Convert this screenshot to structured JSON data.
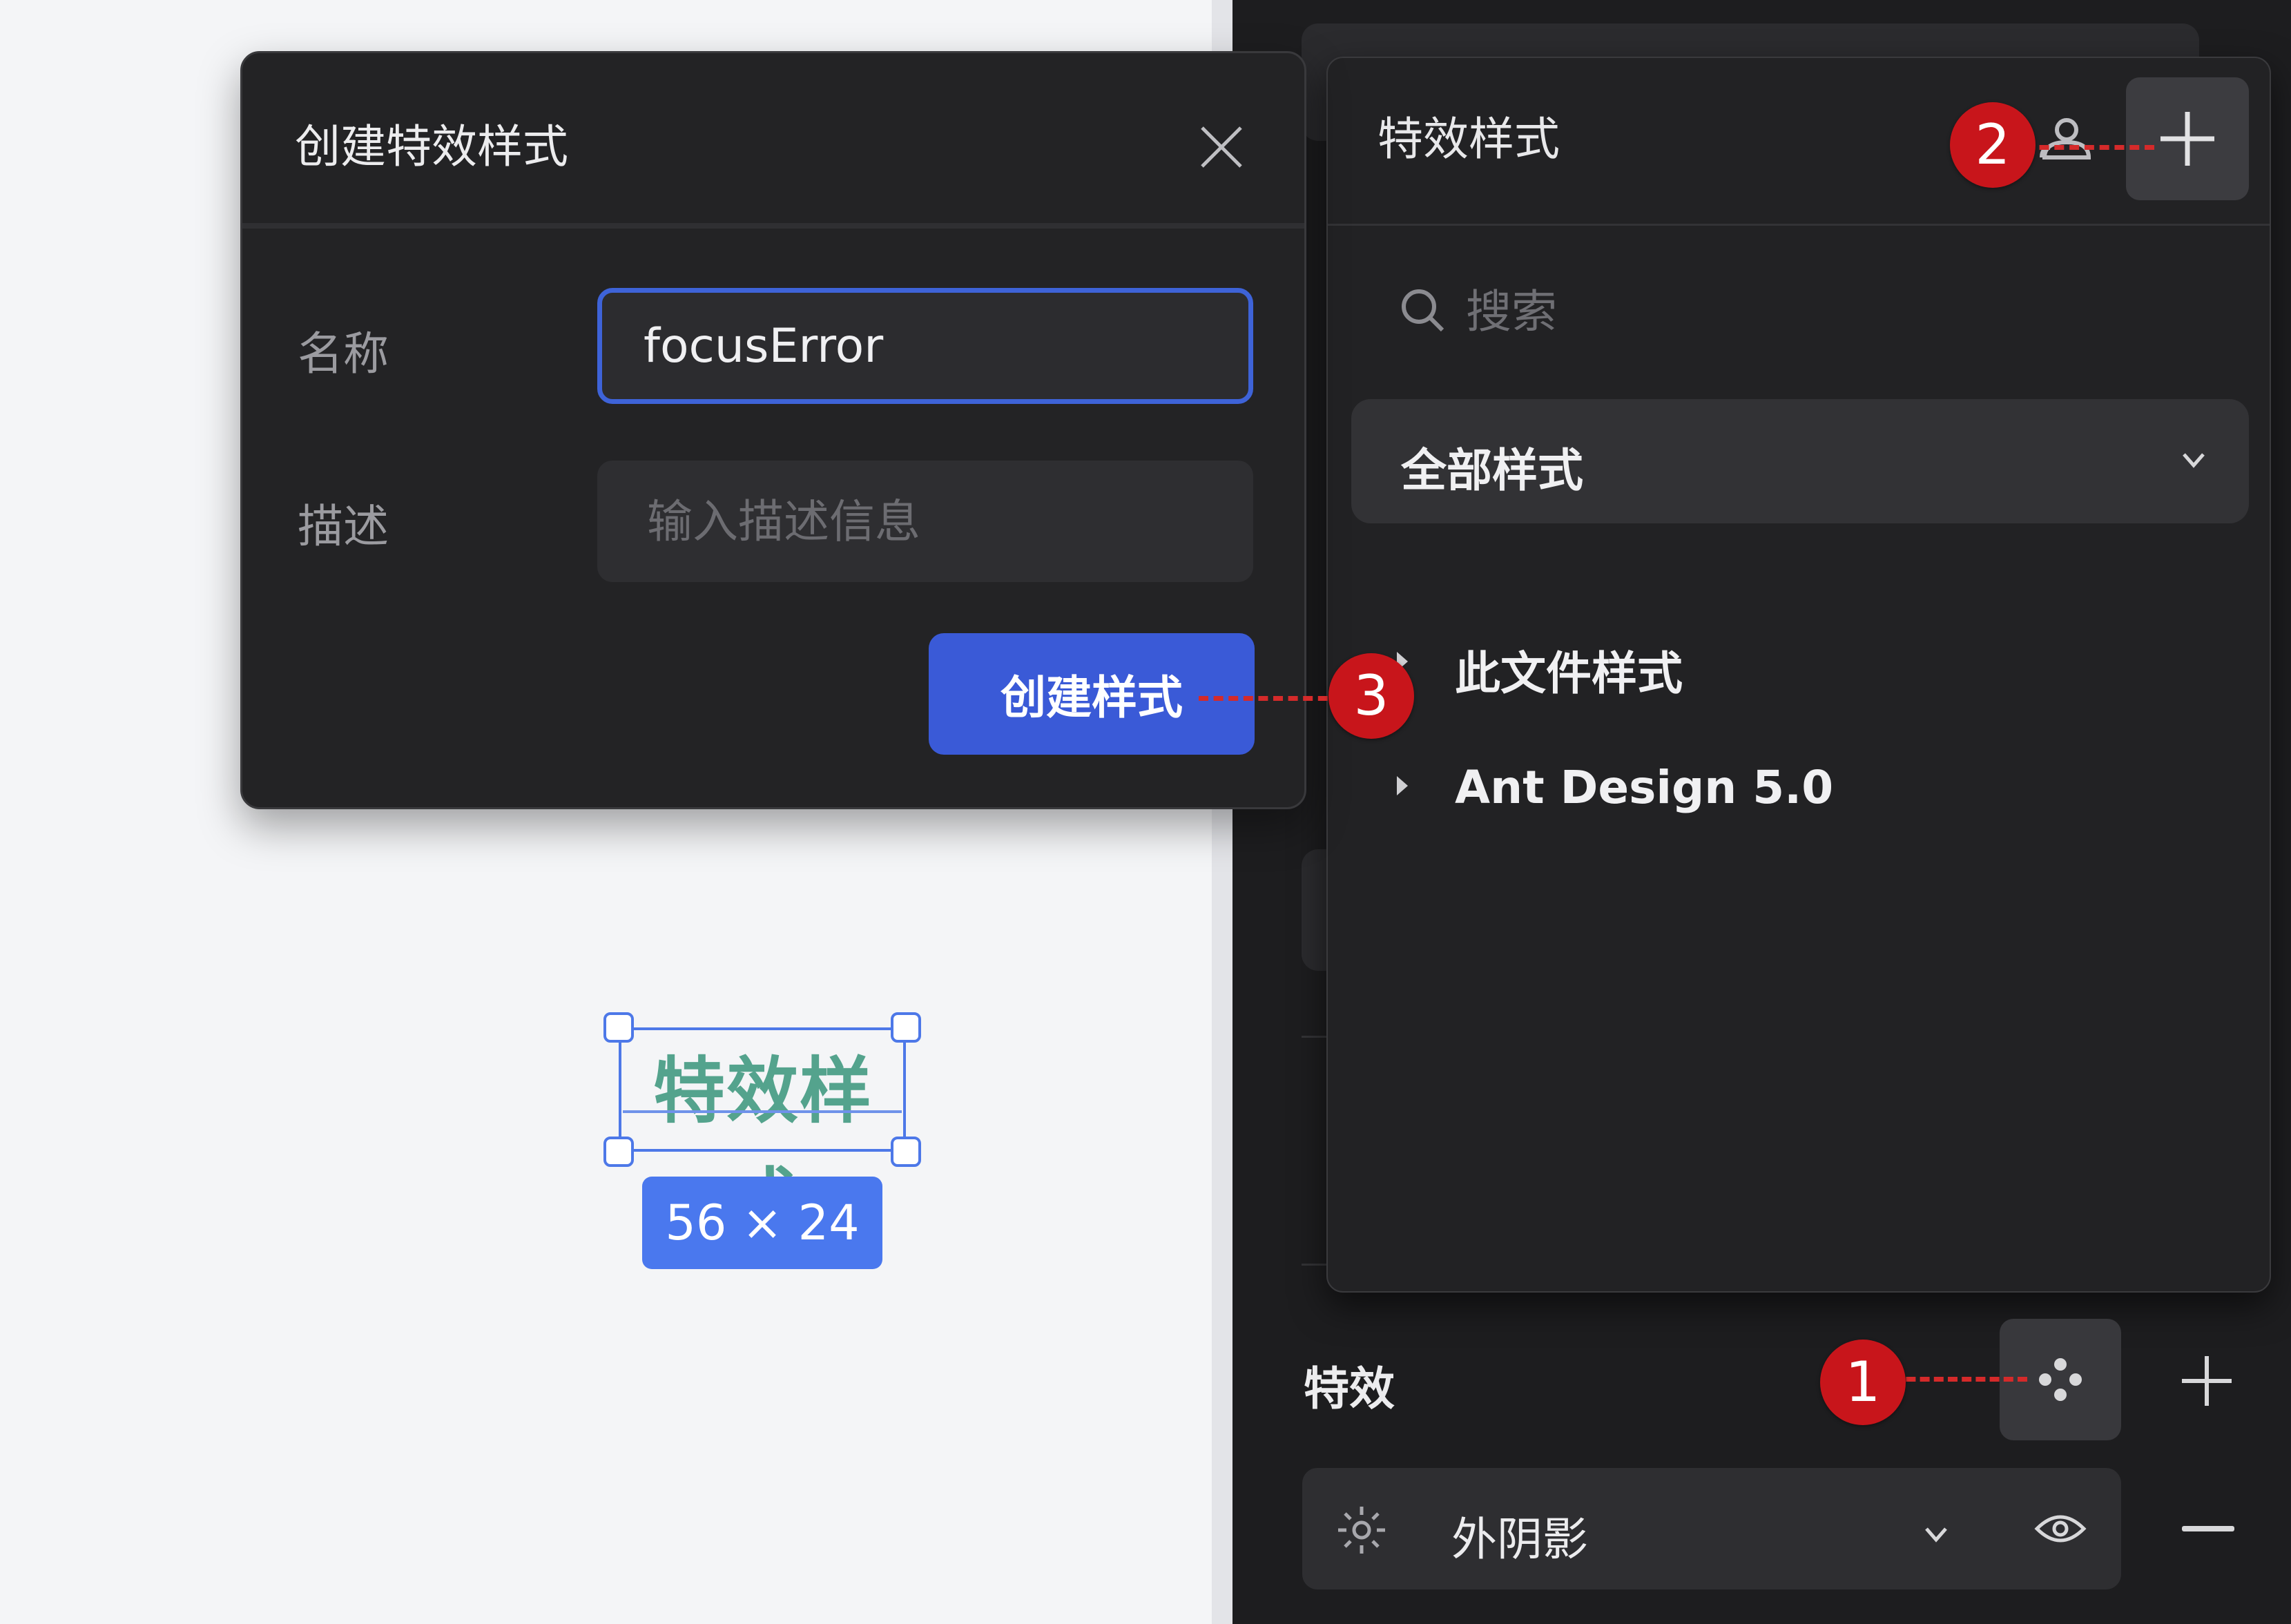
{
  "canvas": {
    "selected_text": "特效样式",
    "size_badge": "56 × 24"
  },
  "dialog": {
    "title": "创建特效样式",
    "name_label": "名称",
    "name_value": "focusError",
    "description_label": "描述",
    "description_placeholder": "输入描述信息",
    "create_button": "创建样式"
  },
  "styles_panel": {
    "title": "特效样式",
    "search_placeholder": "搜索",
    "filter": "全部样式",
    "groups": [
      {
        "label": "此文件样式"
      },
      {
        "label": "Ant Design 5.0"
      }
    ]
  },
  "effects": {
    "title": "特效",
    "effect_type": "外阴影"
  },
  "annotations": [
    "1",
    "2",
    "3"
  ],
  "colors": {
    "accent": "#3a5ad7",
    "marker": "#c8151b",
    "panel_bg": "#222224",
    "text_gradient": "#54a38d"
  }
}
